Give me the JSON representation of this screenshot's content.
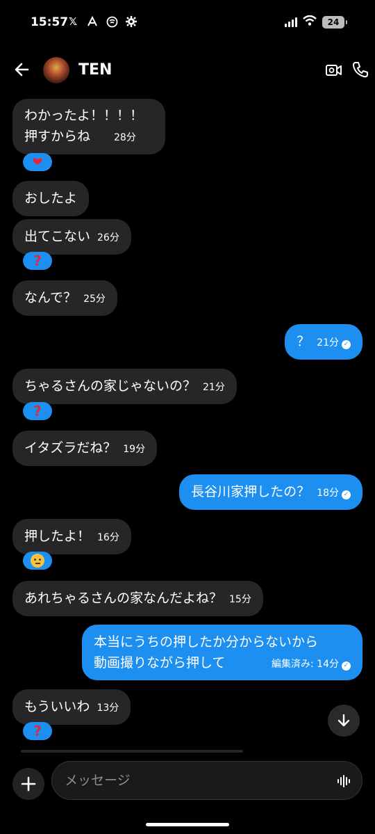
{
  "status_bar": {
    "time": "15:57",
    "battery": "24"
  },
  "header": {
    "title": "TEN"
  },
  "messages": [
    {
      "line1": "わかったよ！！！！",
      "line2": "押すからね",
      "time": "28分"
    },
    {
      "text": "おしたよ"
    },
    {
      "text": "出てこない",
      "time": "26分"
    },
    {
      "text": "なんで？",
      "time": "25分"
    },
    {
      "text": "？",
      "time": "21分"
    },
    {
      "text": "ちゃるさんの家じゃないの？",
      "time": "21分"
    },
    {
      "text": "イタズラだね？",
      "time": "19分"
    },
    {
      "text": "長谷川家押したの？",
      "time": "18分"
    },
    {
      "text": "押したよ！",
      "time": "16分"
    },
    {
      "text": "あれちゃるさんの家なんだよね？",
      "time": "15分"
    },
    {
      "line1": "本当にうちの押したか分からないから",
      "line2": "動画撮りながら押して",
      "time": "編集済み: 14分"
    },
    {
      "text": "もういいわ",
      "time": "13分"
    }
  ],
  "reactions": {
    "heart": "❤",
    "question": "?",
    "thinking": "thinking-face"
  },
  "composer": {
    "placeholder": "メッセージ"
  },
  "colors": {
    "incoming_bubble": "#262629",
    "outgoing_bubble": "#1d8ff0",
    "background": "#000000"
  }
}
